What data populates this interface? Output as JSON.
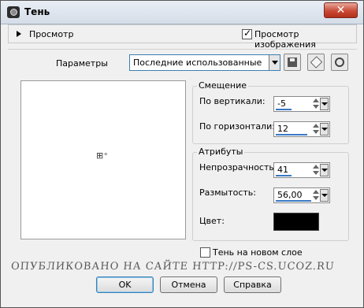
{
  "window": {
    "title": "Тень",
    "close_label": "✕"
  },
  "preview_bar": {
    "toggle_label": "Просмотр",
    "image_preview_label": "Просмотр изображения",
    "image_preview_checked": true
  },
  "params": {
    "label": "Параметры",
    "preset_value": "Последние использованные"
  },
  "canvas": {
    "crosshair_glyph": "⊞⁺"
  },
  "offset": {
    "title": "Смещение",
    "vertical_label": "По вертикали:",
    "vertical_value": "-5",
    "horizontal_label": "По горизонтали:",
    "horizontal_value": "12"
  },
  "attributes": {
    "title": "Атрибуты",
    "opacity_label": "Непрозрачность:",
    "opacity_value": "41",
    "blur_label": "Размытость:",
    "blur_value": "56,00",
    "color_label": "Цвет:",
    "color_value": "#000000"
  },
  "new_layer": {
    "label": "Тень на новом слое",
    "checked": false
  },
  "watermark": "ОПУБЛИКОВАНО   НА САЙТЕ   HTTP://PS-CS.UCOZ.RU",
  "buttons": {
    "ok": "OK",
    "cancel": "Отмена",
    "help": "Справка"
  }
}
